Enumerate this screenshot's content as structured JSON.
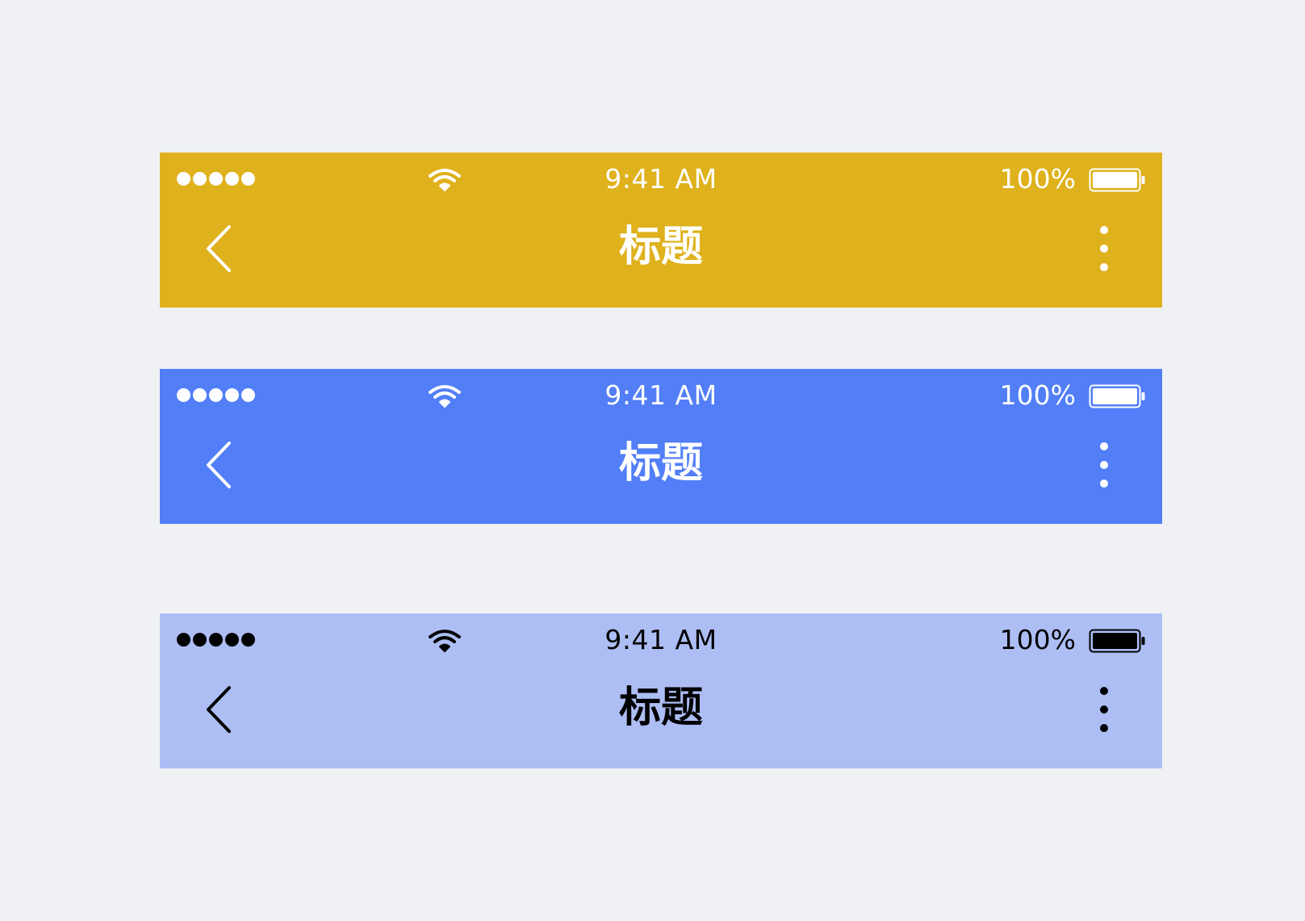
{
  "bars": [
    {
      "background": "#dfb11c",
      "foreground": "#ffffff",
      "status": {
        "time": "9:41 AM",
        "battery": "100%",
        "signal_icon": "signal-dots-icon",
        "wifi_icon": "wifi-icon",
        "battery_icon": "battery-icon"
      },
      "nav": {
        "title": "标题",
        "back_icon": "chevron-left-icon",
        "more_icon": "more-vertical-icon"
      }
    },
    {
      "background": "#527ef7",
      "foreground": "#ffffff",
      "status": {
        "time": "9:41 AM",
        "battery": "100%",
        "signal_icon": "signal-dots-icon",
        "wifi_icon": "wifi-icon",
        "battery_icon": "battery-icon"
      },
      "nav": {
        "title": "标题",
        "back_icon": "chevron-left-icon",
        "more_icon": "more-vertical-icon"
      }
    },
    {
      "background": "#adbef4",
      "foreground": "#000000",
      "status": {
        "time": "9:41 AM",
        "battery": "100%",
        "signal_icon": "signal-dots-icon",
        "wifi_icon": "wifi-icon",
        "battery_icon": "battery-icon"
      },
      "nav": {
        "title": "标题",
        "back_icon": "chevron-left-icon",
        "more_icon": "more-vertical-icon"
      }
    }
  ]
}
